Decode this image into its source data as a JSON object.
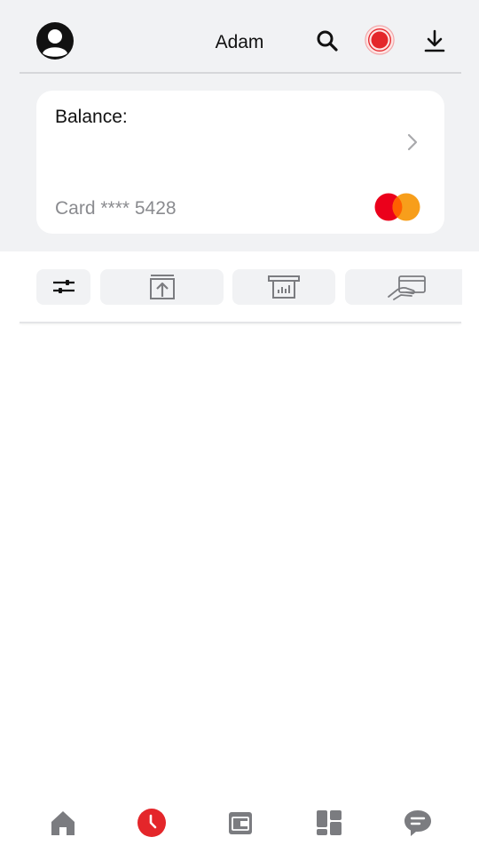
{
  "header": {
    "user_name": "Adam",
    "icons": [
      "avatar-icon",
      "search-icon",
      "record-icon",
      "download-icon"
    ]
  },
  "card": {
    "balance_label": "Balance:",
    "card_number": "Card **** 5428",
    "brand_icon": "mastercard-logo",
    "chevron_icon": "chevron-right-icon"
  },
  "actions": {
    "icons": [
      "filter-icon",
      "upload-icon",
      "atm-icon",
      "card-payment-icon"
    ]
  },
  "bottom_nav": {
    "items": [
      "home-icon",
      "history-icon",
      "wallet-icon",
      "dashboard-icon",
      "chat-icon"
    ],
    "active": "history-icon"
  },
  "colors": {
    "accent": "#e4262a",
    "background": "#f1f2f4",
    "icon_gray": "#7b7c80",
    "mc_red": "#eb001b",
    "mc_orange": "#f79e1b"
  }
}
